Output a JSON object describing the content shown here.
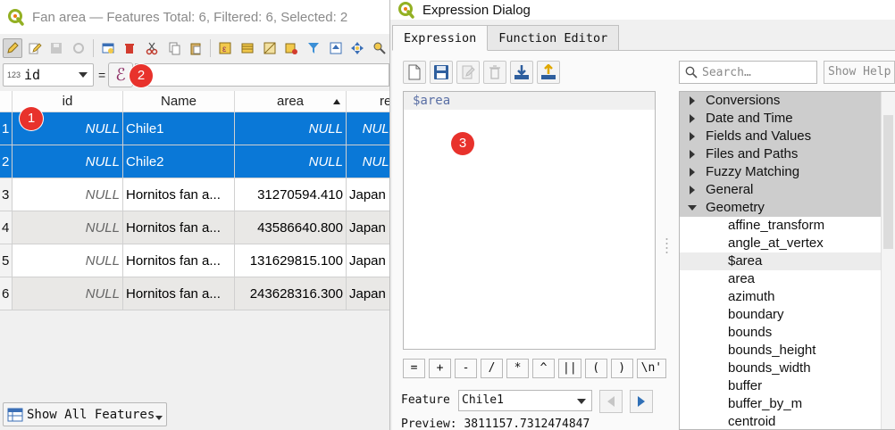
{
  "attribute_window": {
    "title": "Fan area — Features Total: 6, Filtered: 6, Selected: 2",
    "field_combo": {
      "type_badge": "123",
      "value": "id"
    },
    "equals": "=",
    "expression_button": "ℰ",
    "columns": [
      "id",
      "Name",
      "area",
      "re"
    ],
    "rows": [
      {
        "num": "1",
        "id": "NULL",
        "name": "Chile1",
        "area": "NULL",
        "re": "NULL",
        "selected": true
      },
      {
        "num": "2",
        "id": "NULL",
        "name": "Chile2",
        "area": "NULL",
        "re": "NULL",
        "selected": true
      },
      {
        "num": "3",
        "id": "NULL",
        "name": "Hornitos fan a...",
        "area": "31270594.410",
        "re": "Japan",
        "selected": false
      },
      {
        "num": "4",
        "id": "NULL",
        "name": "Hornitos fan a...",
        "area": "43586640.800",
        "re": "Japan",
        "selected": false
      },
      {
        "num": "5",
        "id": "NULL",
        "name": "Hornitos fan a...",
        "area": "131629815.100",
        "re": "Japan",
        "selected": false
      },
      {
        "num": "6",
        "id": "NULL",
        "name": "Hornitos fan a...",
        "area": "243628316.300",
        "re": "Japan",
        "selected": false
      }
    ],
    "show_all": "Show All Features"
  },
  "expression_dialog": {
    "title": "Expression Dialog",
    "tabs": [
      "Expression",
      "Function Editor"
    ],
    "expression_text": "$area",
    "operators": [
      "=",
      "+",
      "-",
      "/",
      "*",
      "^",
      "||",
      "(",
      ")",
      "\\n'"
    ],
    "feature_label": "Feature",
    "feature_value": "Chile1",
    "preview": "Preview: 3811157.7312474847",
    "search_placeholder": "Search…",
    "show_help": "Show Help",
    "tree_groups": [
      "Conversions",
      "Date and Time",
      "Fields and Values",
      "Files and Paths",
      "Fuzzy Matching",
      "General",
      "Geometry"
    ],
    "tree_leaves": [
      "affine_transform",
      "angle_at_vertex",
      "$area",
      "area",
      "azimuth",
      "boundary",
      "bounds",
      "bounds_height",
      "bounds_width",
      "buffer",
      "buffer_by_m",
      "centroid"
    ]
  },
  "markers": [
    "1",
    "2",
    "3"
  ],
  "colors": {
    "selection": "#0a78d7",
    "marker": "#e8322c",
    "qgis_green": "#93b023"
  }
}
